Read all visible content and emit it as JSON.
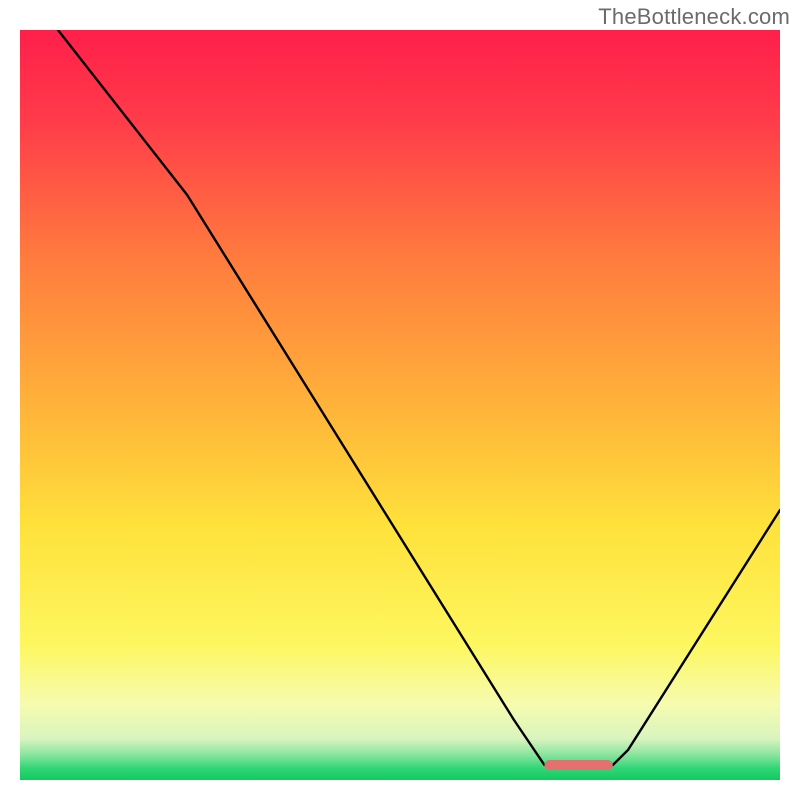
{
  "watermark": "TheBottleneck.com",
  "chart_data": {
    "type": "line",
    "title": "",
    "xlabel": "",
    "ylabel": "",
    "xlim": [
      0,
      100
    ],
    "ylim": [
      0,
      100
    ],
    "x": [
      0,
      5,
      22,
      65,
      69,
      78,
      80,
      100
    ],
    "values": [
      108,
      100,
      78,
      8,
      2,
      2,
      4,
      36
    ],
    "valley_marker": {
      "x_start": 69,
      "x_end": 78,
      "y": 2
    },
    "background": "rainbow-vertical-gradient",
    "gradient_stops": [
      {
        "pos": 0,
        "color": "#ff1f4b"
      },
      {
        "pos": 0.12,
        "color": "#ff3b4a"
      },
      {
        "pos": 0.3,
        "color": "#ff7a3e"
      },
      {
        "pos": 0.5,
        "color": "#ffb23a"
      },
      {
        "pos": 0.66,
        "color": "#ffe13b"
      },
      {
        "pos": 0.82,
        "color": "#fdf760"
      },
      {
        "pos": 0.9,
        "color": "#f6fbb0"
      },
      {
        "pos": 0.945,
        "color": "#d9f4bf"
      },
      {
        "pos": 0.965,
        "color": "#8ee6a0"
      },
      {
        "pos": 0.985,
        "color": "#2fd675"
      },
      {
        "pos": 1.0,
        "color": "#13c95e"
      }
    ]
  }
}
